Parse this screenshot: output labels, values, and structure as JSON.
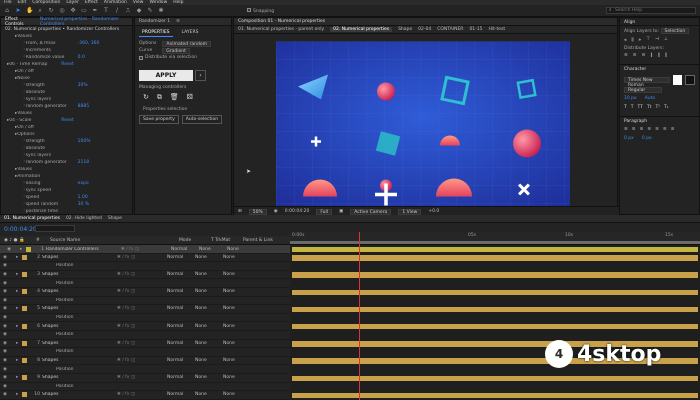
{
  "menubar": {
    "items": [
      "File",
      "Edit",
      "Composition",
      "Layer",
      "Effect",
      "Animation",
      "View",
      "Window",
      "Help"
    ]
  },
  "toolbar": {
    "snapping_label": "Snapping",
    "search_placeholder": "Search Help"
  },
  "effects_panel": {
    "tabs": [
      "Effect Controls",
      "Numerical properties - Randomizer Controllers"
    ],
    "breadcrumb": "02. Numerical properties • Randomizer Controllers",
    "rows": [
      {
        "label": "Values",
        "value": "",
        "indent": 1
      },
      {
        "label": "From, Δ fmax",
        "value": "-360, 360",
        "indent": 2
      },
      {
        "label": "Increments",
        "value": "",
        "indent": 2
      },
      {
        "label": "Randomize value",
        "value": "0.0",
        "indent": 2
      },
      {
        "label": "06 · Time Remap",
        "value": "Reset",
        "indent": 0
      },
      {
        "label": "On / off",
        "value": "",
        "indent": 1
      },
      {
        "label": "Noise",
        "value": "",
        "indent": 1
      },
      {
        "label": "strength",
        "value": "30%",
        "indent": 2
      },
      {
        "label": "absolute",
        "value": "",
        "indent": 2
      },
      {
        "label": "sync layers",
        "value": "",
        "indent": 2
      },
      {
        "label": "random generator",
        "value": "8885",
        "indent": 2
      },
      {
        "label": "Values",
        "value": "",
        "indent": 1
      },
      {
        "label": "04 · Scale",
        "value": "Reset",
        "indent": 0
      },
      {
        "label": "On / off",
        "value": "",
        "indent": 1
      },
      {
        "label": "Options",
        "value": "",
        "indent": 1
      },
      {
        "label": "strength",
        "value": "100%",
        "indent": 2
      },
      {
        "label": "absolute",
        "value": "",
        "indent": 2
      },
      {
        "label": "sync layers",
        "value": "",
        "indent": 2
      },
      {
        "label": "random generator",
        "value": "2118",
        "indent": 2
      },
      {
        "label": "Values",
        "value": "",
        "indent": 1
      },
      {
        "label": "Animation",
        "value": "",
        "indent": 1
      },
      {
        "label": "easing",
        "value": "expo",
        "indent": 2
      },
      {
        "label": "sync speed",
        "value": "",
        "indent": 2
      },
      {
        "label": "speed",
        "value": "1.00",
        "indent": 2
      },
      {
        "label": "speed random",
        "value": "30 %",
        "indent": 2
      },
      {
        "label": "posterize time",
        "value": "",
        "indent": 2
      },
      {
        "label": "Randomizer · Layer",
        "value": "Reset",
        "indent": 0
      },
      {
        "label": "layer speed",
        "value": "40",
        "indent": 1
      }
    ]
  },
  "properties_panel": {
    "title": "Randomizer 1",
    "tabs": [
      "PROPERTIES",
      "LAYERS"
    ],
    "options_label": "Options",
    "options_value": "Animated random",
    "curve_label": "Curve",
    "curve_value": "Gradient",
    "checkbox_label": "Distribute via selection",
    "apply_label": "APPLY",
    "managing_label": "Managing controllers",
    "properties_selection_label": "Properties selection",
    "save_label": "Save property",
    "auto_label": "Auto-selection"
  },
  "viewer": {
    "title": "Composition 01 - Numerical properties",
    "tabs": [
      "01. Numerical properties - parent only",
      "02. Numerical properties",
      "Shape",
      "02-04",
      "CONTAINER",
      "01-15",
      "Hit-test"
    ],
    "footer": {
      "zoom": "50%",
      "timecode": "0:00:04:20",
      "quality": "Full",
      "camera": "Active Camera",
      "views": "1 View",
      "offset": "+0.0"
    }
  },
  "right_panel": {
    "align_label": "Align",
    "align_layers_to": "Align Layers to:",
    "align_to_value": "Selection",
    "distribute_label": "Distribute Layers:",
    "character_label": "Character",
    "font_name": "Times New Roman",
    "font_style": "Regular",
    "paragraph_label": "Paragraph",
    "font_size": "10 px",
    "leading": "Auto"
  },
  "timeline": {
    "tabs": [
      "01. Numerical properties",
      "02. Hide lighted",
      "Shape"
    ],
    "timecode": "0:00:04:20",
    "columns": [
      "#",
      "Source Name",
      "Mode",
      "T TrkMat",
      "Parent & Link"
    ],
    "ruler_ticks": [
      "0:00s",
      "05s",
      "10s",
      "15s"
    ],
    "layers": [
      {
        "num": "1",
        "name": "Randomizer Controllers",
        "mode": "Normal",
        "trk": "None",
        "parent": "None",
        "kind": "main",
        "color": "#c4b440"
      },
      {
        "num": "2",
        "name": "Shapes",
        "mode": "Normal",
        "trk": "None",
        "parent": "None",
        "kind": "layer",
        "color": "#c9a14a"
      },
      {
        "num": "",
        "name": "Position",
        "mode": "",
        "trk": "",
        "parent": "",
        "kind": "sub",
        "color": ""
      },
      {
        "num": "3",
        "name": "Shapes",
        "mode": "Normal",
        "trk": "None",
        "parent": "None",
        "kind": "layer",
        "color": "#c9a14a"
      },
      {
        "num": "",
        "name": "Position",
        "mode": "",
        "trk": "",
        "parent": "",
        "kind": "sub",
        "color": ""
      },
      {
        "num": "4",
        "name": "Shapes",
        "mode": "Normal",
        "trk": "None",
        "parent": "None",
        "kind": "layer",
        "color": "#c9a14a"
      },
      {
        "num": "",
        "name": "Position",
        "mode": "",
        "trk": "",
        "parent": "",
        "kind": "sub",
        "color": ""
      },
      {
        "num": "5",
        "name": "Shapes",
        "mode": "Normal",
        "trk": "None",
        "parent": "None",
        "kind": "layer",
        "color": "#c9a14a"
      },
      {
        "num": "",
        "name": "Position",
        "mode": "",
        "trk": "",
        "parent": "",
        "kind": "sub",
        "color": ""
      },
      {
        "num": "6",
        "name": "Shapes",
        "mode": "Normal",
        "trk": "None",
        "parent": "None",
        "kind": "layer",
        "color": "#c9a14a"
      },
      {
        "num": "",
        "name": "Position",
        "mode": "",
        "trk": "",
        "parent": "",
        "kind": "sub",
        "color": ""
      },
      {
        "num": "7",
        "name": "Shapes",
        "mode": "Normal",
        "trk": "None",
        "parent": "None",
        "kind": "layer",
        "color": "#c9a14a"
      },
      {
        "num": "",
        "name": "Position",
        "mode": "",
        "trk": "",
        "parent": "",
        "kind": "sub",
        "color": ""
      },
      {
        "num": "8",
        "name": "Shapes",
        "mode": "Normal",
        "trk": "None",
        "parent": "None",
        "kind": "layer",
        "color": "#c9a14a"
      },
      {
        "num": "",
        "name": "Position",
        "mode": "",
        "trk": "",
        "parent": "",
        "kind": "sub",
        "color": ""
      },
      {
        "num": "9",
        "name": "Shapes",
        "mode": "Normal",
        "trk": "None",
        "parent": "None",
        "kind": "layer",
        "color": "#c9a14a"
      },
      {
        "num": "",
        "name": "Position",
        "mode": "",
        "trk": "",
        "parent": "",
        "kind": "sub",
        "color": ""
      },
      {
        "num": "10",
        "name": "Shapes",
        "mode": "Normal",
        "trk": "None",
        "parent": "None",
        "kind": "layer",
        "color": "#c9a14a"
      }
    ]
  },
  "watermark": {
    "text": "4sktop",
    "logo": "4"
  }
}
